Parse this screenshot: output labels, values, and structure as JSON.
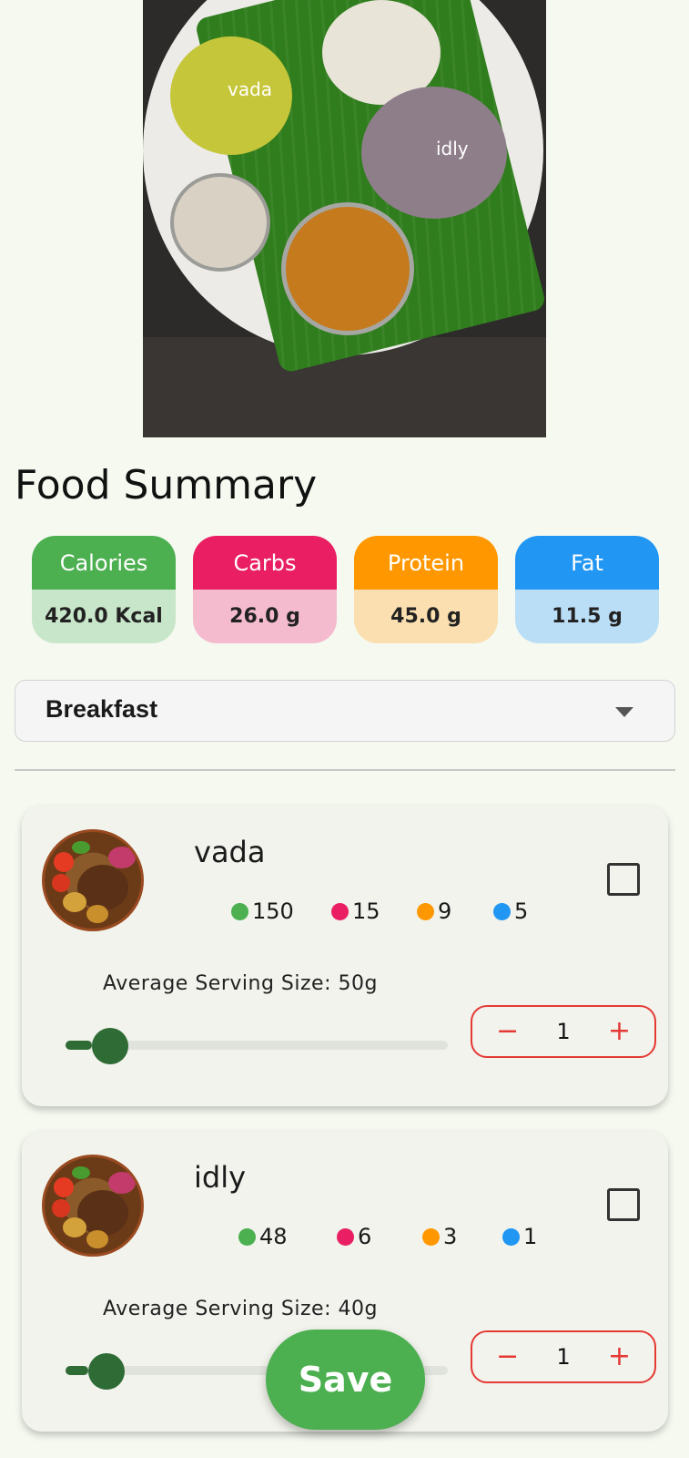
{
  "photo": {
    "labels": {
      "vada": "vada",
      "idly": "idly"
    }
  },
  "title": "Food Summary",
  "nutrients": [
    {
      "label": "Calories",
      "value": "420.0 Kcal",
      "color": "#4caf50"
    },
    {
      "label": "Carbs",
      "value": "26.0 g",
      "color": "#e91e63"
    },
    {
      "label": "Protein",
      "value": "45.0 g",
      "color": "#ff9800"
    },
    {
      "label": "Fat",
      "value": "11.5 g",
      "color": "#2196f3"
    }
  ],
  "meal_select": {
    "value": "Breakfast"
  },
  "foods": [
    {
      "name": "vada",
      "calories": "150",
      "carbs": "15",
      "protein": "9",
      "fat": "5",
      "serving": "Average Serving Size: 50g",
      "quantity": "1",
      "slider_fraction": 0.07
    },
    {
      "name": "idly",
      "calories": "48",
      "carbs": "6",
      "protein": "3",
      "fat": "1",
      "serving": "Average Serving Size: 40g",
      "quantity": "1",
      "slider_fraction": 0.06
    }
  ],
  "stepper_labels": {
    "minus": "−",
    "plus": "+"
  },
  "save_label": "Save"
}
